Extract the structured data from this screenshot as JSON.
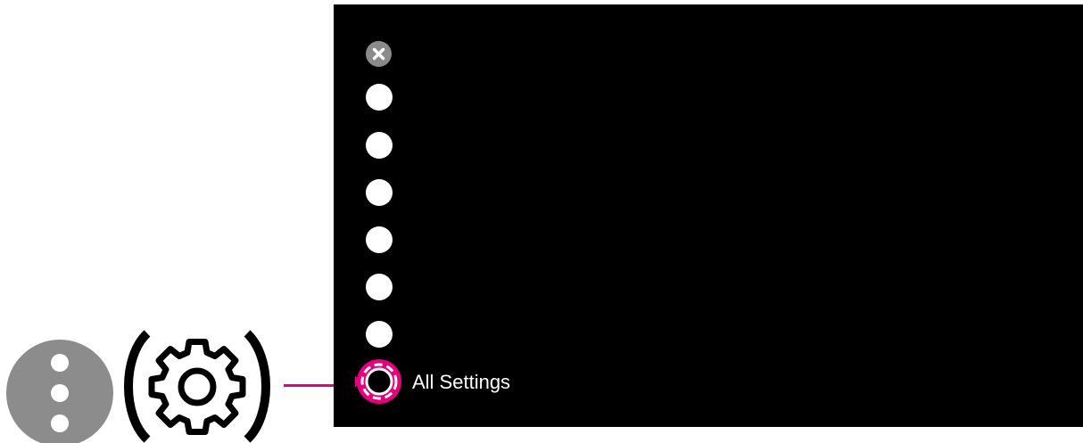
{
  "remote": {
    "more_button_icon": "vertical-dots-icon",
    "settings_button_icon": "gear-icon"
  },
  "menu": {
    "close_icon": "close-icon",
    "item_icon": "menu-dot-icon",
    "settings": {
      "label": "All Settings",
      "icon": "settings-ring-icon"
    }
  },
  "colors": {
    "screen_background": "#000000",
    "callout": "#e6007e",
    "remote_button": "#8c8c8c",
    "dot": "#ffffff"
  }
}
